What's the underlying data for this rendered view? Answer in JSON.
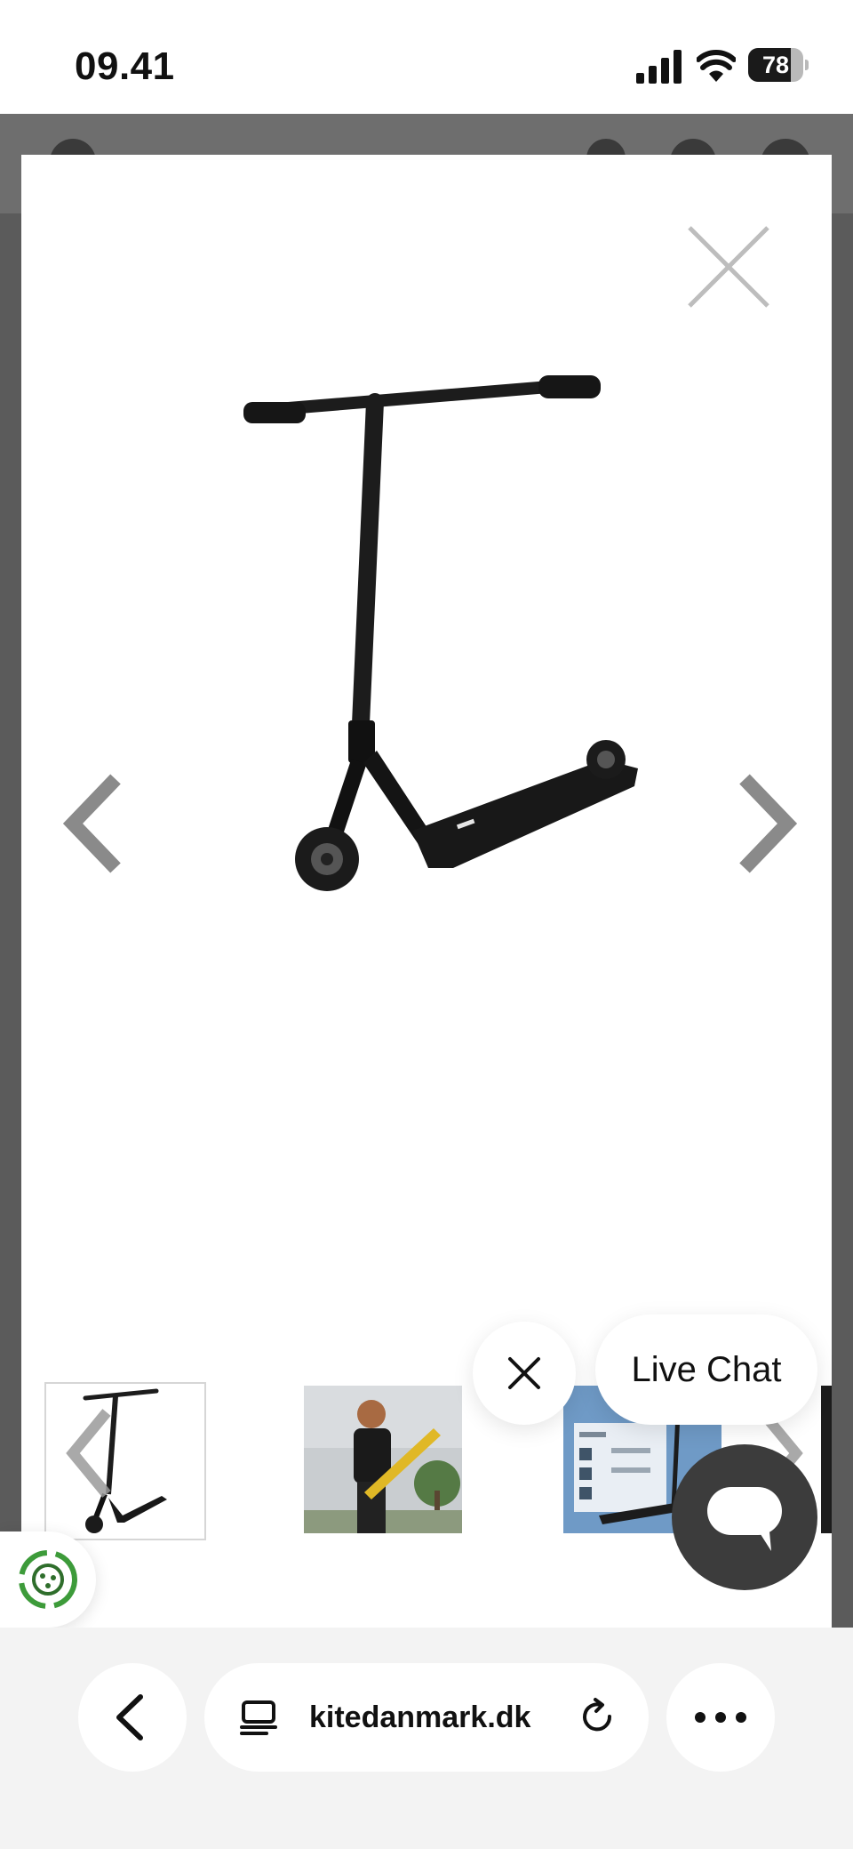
{
  "status_bar": {
    "time": "09.41",
    "battery": "78"
  },
  "modal": {
    "live_chat_label": "Live Chat"
  },
  "browser": {
    "url": "kitedanmark.dk"
  },
  "icons": {
    "close": "close-icon",
    "prev": "chevron-left-icon",
    "next": "chevron-right-icon",
    "chat": "chat-bubble-icon",
    "cookie": "cookie-consent-icon",
    "back": "chevron-left-icon",
    "reader": "reader-mode-icon",
    "reload": "reload-icon",
    "more": "more-icon"
  }
}
